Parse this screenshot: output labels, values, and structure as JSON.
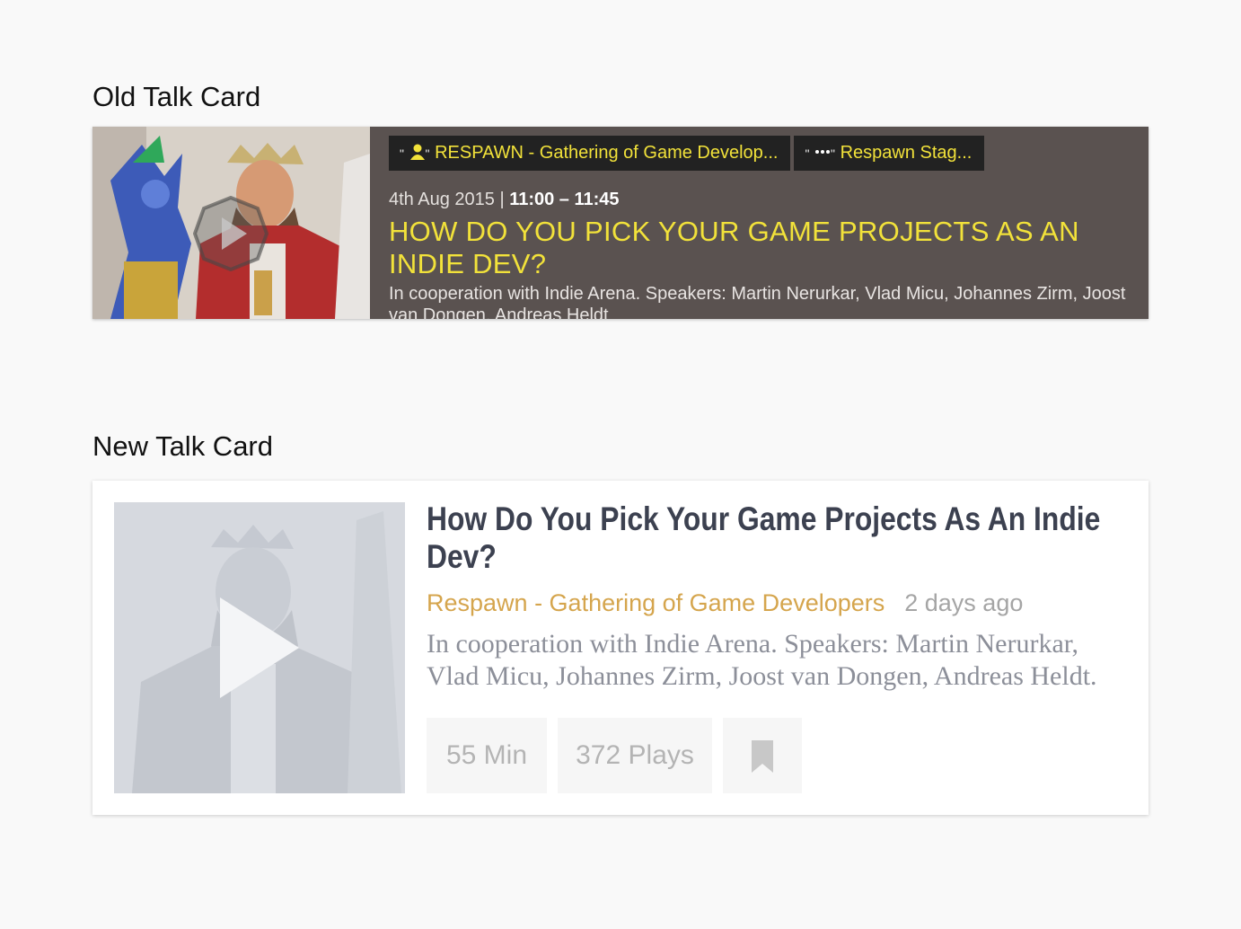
{
  "sections": {
    "old_heading": "Old Talk Card",
    "new_heading": "New Talk Card"
  },
  "old_card": {
    "tags": [
      {
        "icon": "person-icon",
        "quote_open": "\"",
        "quote_close": "\"",
        "label": "RESPAWN - Gathering of Game Develop..."
      },
      {
        "icon": "ellipsis-icon",
        "quote_open": "\"",
        "quote_close": "\"",
        "label": "Respawn Stag..."
      }
    ],
    "date": "4th Aug 2015 | ",
    "time": "11:00 – 11:45",
    "title": "HOW DO YOU PICK YOUR GAME PROJECTS AS AN INDIE DEV?",
    "description": "In cooperation with Indie Arena. Speakers: Martin Nerurkar, Vlad Micu, Johannes Zirm, Joost van Dongen, Andreas Heldt",
    "colors": {
      "background": "#5a5250",
      "accent": "#f2e23a",
      "tag_bg": "#222222"
    }
  },
  "new_card": {
    "title": "How Do You Pick Your Game Projects As An Indie Dev?",
    "category": "Respawn - Gathering of Game Developers",
    "age": "2 days ago",
    "description": "In cooperation with Indie Arena. Speakers: Martin Nerurkar, Vlad Micu, Johannes Zirm, Joost van Dongen, Andreas Heldt.",
    "duration": "55 Min",
    "plays": "372 Plays",
    "bookmark_icon": "bookmark-icon",
    "colors": {
      "title": "#3c4150",
      "category": "#d5a54d",
      "muted": "#a5a5a5"
    }
  }
}
